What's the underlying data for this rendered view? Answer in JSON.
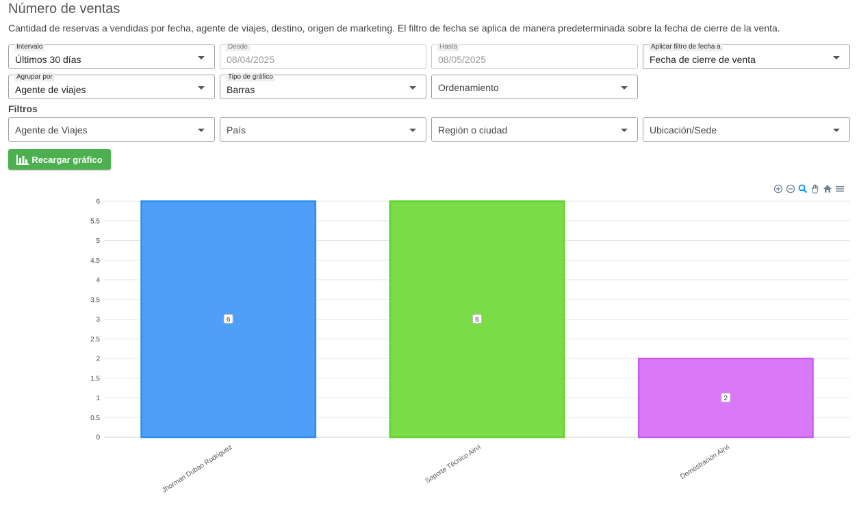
{
  "header": {
    "title": "Número de ventas",
    "subtitle": "Cantidad de reservas a vendidas por fecha, agente de viajes, destino, origen de marketing. El filtro de fecha se aplica de manera predeterminada sobre la fecha de cierre de la venta."
  },
  "controls": {
    "intervalo": {
      "label": "Intervalo",
      "value": "Últimos 30 días"
    },
    "desde": {
      "label": "Desde",
      "value": "08/04/2025"
    },
    "hasta": {
      "label": "Hasta",
      "value": "08/05/2025"
    },
    "aplicar": {
      "label": "Aplicar filtro de fecha a",
      "value": "Fecha de cierre de venta"
    },
    "agrupar": {
      "label": "Agrupar por",
      "value": "Agente de viajes"
    },
    "tipo": {
      "label": "Tipo de gráfico",
      "value": "Barras"
    },
    "ordenamiento": {
      "placeholder": "Ordenamiento"
    }
  },
  "filters": {
    "heading": "Filtros",
    "agente": "Agente de Viajes",
    "pais": "País",
    "region": "Región o ciudad",
    "ubicacion": "Ubicación/Sede"
  },
  "reload_label": "Recargar gráfico",
  "toolbar_icons": [
    "zoom-in-icon",
    "zoom-out-icon",
    "selection-zoom-icon",
    "pan-hand-icon",
    "home-reset-icon",
    "menu-icon"
  ],
  "chart_data": {
    "type": "bar",
    "categories": [
      "Jhorman Duban Rodriguez",
      "Soporte Técnico Airvi",
      "Demostración Airvi"
    ],
    "values": [
      6,
      6,
      2
    ],
    "colors": [
      "#4e9ff7",
      "#7add48",
      "#da79f7"
    ],
    "border_colors": [
      "#2e8ef0",
      "#62d22e",
      "#c95af0"
    ],
    "y_ticks": [
      "0",
      "0.5",
      "1",
      "1.5",
      "2",
      "2.5",
      "3",
      "3.5",
      "4",
      "4.5",
      "5",
      "5.5",
      "6"
    ],
    "ylim": [
      0,
      6
    ],
    "data_labels": [
      "6",
      "6",
      "2"
    ],
    "grid": true,
    "title": "",
    "xlabel": "",
    "ylabel": ""
  }
}
